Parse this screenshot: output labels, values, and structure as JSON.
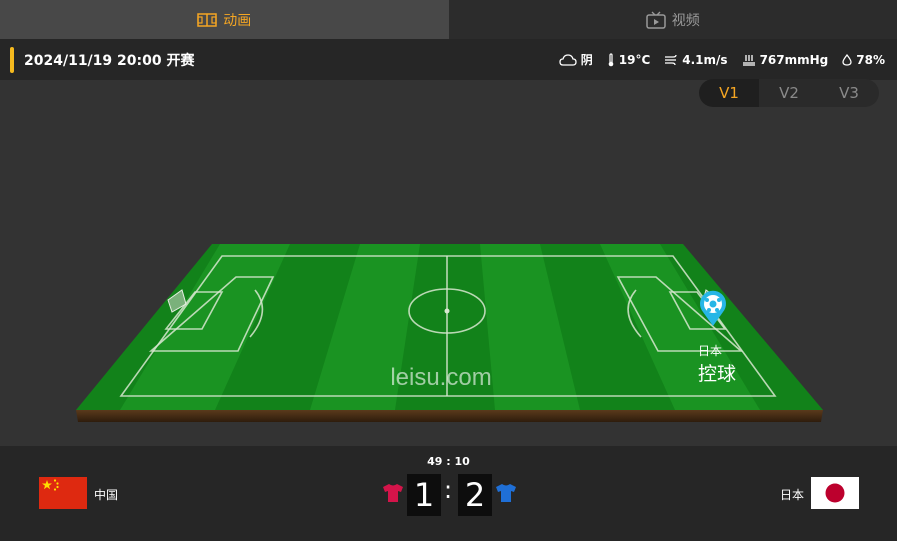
{
  "tabs": [
    {
      "label": "动画",
      "icon": "pitch-icon",
      "active": true
    },
    {
      "label": "视频",
      "icon": "tv-icon",
      "active": false
    }
  ],
  "match": {
    "start_time": "2024/11/19 20:00 开赛"
  },
  "weather": {
    "condition": "阴",
    "temperature": "19°C",
    "wind": "4.1m/s",
    "pressure": "767mmHg",
    "humidity": "78%"
  },
  "versions": [
    "V1",
    "V2",
    "V3"
  ],
  "pitch": {
    "watermark": "leisu.com",
    "event_team": "日本",
    "event_label": "控球"
  },
  "scoreboard": {
    "clock": "49 : 10",
    "home": {
      "name": "中国",
      "score": "1",
      "shirt_color": "#d4144a"
    },
    "away": {
      "name": "日本",
      "score": "2",
      "shirt_color": "#1f6fd6"
    },
    "separator": ":"
  },
  "colors": {
    "accent": "#f5a623",
    "pitch_dark": "#0f7a15",
    "pitch_light": "#1c9424",
    "marker": "#27b6e6"
  }
}
